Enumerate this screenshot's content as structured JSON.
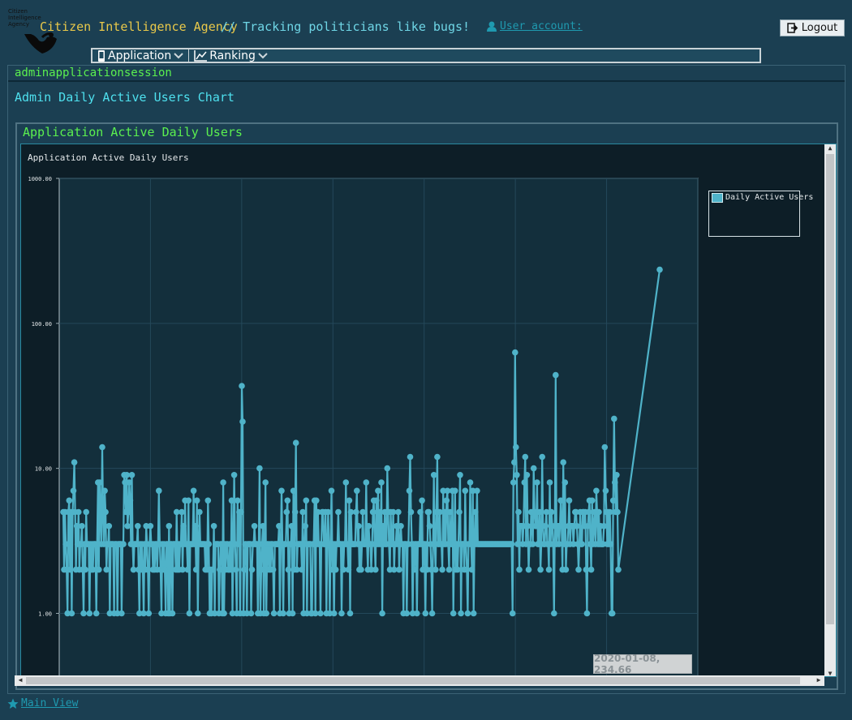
{
  "header": {
    "logo_text": "Citizen Intelligence Agency",
    "title": "Citizen Intelligence Agency",
    "tagline": "// Tracking politicians like bugs!",
    "user_account_label": "User account:",
    "logout_label": "Logout"
  },
  "menu": {
    "items": [
      {
        "label": "Application",
        "icon": "mobile-icon"
      },
      {
        "label": "Ranking",
        "icon": "line-chart-icon"
      }
    ]
  },
  "page": {
    "name": "adminapplicationsession",
    "title": "Admin Daily Active Users Chart",
    "section_title": "Application Active Daily Users",
    "chart_caption": "Application Active Daily Users"
  },
  "tooltip": "2020-01-08, 234.66",
  "footer": {
    "main_view_label": "Main View"
  },
  "colors": {
    "background": "#1b3f52",
    "chart_bg": "#0d1e27",
    "series": "#4fb3c9",
    "title": "#e8c84a",
    "tagline": "#6fd6e6",
    "green_label": "#5bf04f",
    "cyan_label": "#4ee0ee"
  },
  "chart_data": {
    "type": "line",
    "title": "Application Active Daily Users",
    "y_scale": "log",
    "ylim": [
      0.35,
      1000
    ],
    "y_ticks": [
      "1000.00",
      "100.00",
      "10.00",
      "1.00"
    ],
    "y_tick_values": [
      1000,
      100,
      10,
      1
    ],
    "grid": true,
    "legend_position": "right",
    "series": [
      {
        "name": "Daily Active Users",
        "values": [
          5,
          2,
          5,
          3,
          2,
          1,
          5,
          6,
          2,
          5,
          1,
          5,
          7,
          11,
          5,
          2,
          4,
          3,
          5,
          2,
          3,
          3,
          4,
          2,
          1,
          3,
          2,
          5,
          3,
          3,
          3,
          1,
          3,
          2,
          3,
          2,
          3,
          3,
          3,
          1,
          3,
          8,
          2,
          8,
          5,
          3,
          14,
          5,
          3,
          7,
          5,
          2,
          3,
          3,
          4,
          1,
          3,
          3,
          3,
          3,
          1,
          3,
          3,
          3,
          1,
          3,
          3,
          3,
          3,
          1,
          3,
          3,
          9,
          8,
          5,
          9,
          4,
          5,
          8,
          6,
          3,
          9,
          3,
          2,
          3,
          3,
          3,
          3,
          4,
          2,
          1,
          3,
          2,
          3,
          2,
          1,
          3,
          2,
          4,
          3,
          2,
          1,
          3,
          4,
          3,
          3,
          2,
          3,
          2,
          3,
          3,
          2,
          3,
          7,
          3,
          2,
          1,
          3,
          2,
          3,
          2,
          1,
          3,
          3,
          1,
          4,
          1,
          3,
          3,
          1,
          3,
          3,
          3,
          2,
          5,
          2,
          3,
          2,
          3,
          3,
          5,
          2,
          4,
          3,
          6,
          3,
          3,
          2,
          6,
          1,
          3,
          3,
          3,
          3,
          7,
          3,
          4,
          2,
          6,
          1,
          3,
          5,
          3,
          3,
          3,
          3,
          3,
          3,
          2,
          3,
          2,
          6,
          3,
          1,
          2,
          1,
          2,
          2,
          4,
          1,
          3,
          3,
          3,
          3,
          1,
          2,
          3,
          3,
          1,
          8,
          1,
          3,
          2,
          3,
          3,
          2,
          2,
          3,
          2,
          6,
          1,
          3,
          9,
          3,
          2,
          1,
          6,
          3,
          5,
          1,
          5,
          37,
          21,
          1,
          2,
          3,
          3,
          1,
          3,
          3,
          3,
          3,
          1,
          2,
          3,
          3,
          4,
          3,
          3,
          3,
          1,
          3,
          10,
          1,
          2,
          3,
          4,
          1,
          3,
          8,
          1,
          3,
          3,
          2,
          3,
          2,
          3,
          3,
          2,
          1,
          3,
          3,
          3,
          3,
          3,
          4,
          1,
          3,
          7,
          3,
          1,
          3,
          3,
          3,
          5,
          6,
          2,
          1,
          3,
          3,
          4,
          1,
          7,
          2,
          5,
          15,
          2,
          3,
          3,
          3,
          3,
          3,
          2,
          5,
          1,
          3,
          4,
          6,
          1,
          3,
          3,
          3,
          3,
          1,
          1,
          3,
          3,
          6,
          1,
          6,
          3,
          5,
          3,
          3,
          1,
          3,
          5,
          5,
          3,
          3,
          5,
          1,
          3,
          5,
          3,
          1,
          3,
          7,
          2,
          3,
          1,
          3,
          2,
          3,
          3,
          5,
          3,
          3,
          3,
          1,
          3,
          2,
          3,
          3,
          8,
          3,
          3,
          2,
          6,
          1,
          5,
          3,
          3,
          3,
          3,
          3,
          5,
          7,
          3,
          4,
          2,
          3,
          2,
          3,
          5,
          3,
          3,
          3,
          8,
          3,
          2,
          4,
          3,
          3,
          2,
          3,
          5,
          6,
          3,
          2,
          6,
          3,
          7,
          3,
          5,
          3,
          8,
          1,
          4,
          3,
          5,
          3,
          3,
          10,
          5,
          3,
          2,
          5,
          3,
          3,
          5,
          2,
          3,
          3,
          4,
          3,
          5,
          2,
          3,
          4,
          3,
          3,
          1,
          3,
          3,
          3,
          1,
          3,
          3,
          7,
          12,
          5,
          3,
          1,
          3,
          2,
          3,
          3,
          1,
          3,
          3,
          3,
          5,
          3,
          6,
          2,
          3,
          3,
          1,
          3,
          2,
          5,
          5,
          4,
          3,
          2,
          1,
          3,
          9,
          3,
          2,
          5,
          12,
          3,
          3,
          5,
          3,
          3,
          2,
          7,
          3,
          5,
          3,
          6,
          7,
          3,
          2,
          5,
          3,
          3,
          7,
          1,
          3,
          7,
          2,
          3,
          2,
          3,
          5,
          9,
          1,
          3,
          3,
          3,
          2,
          7,
          3,
          2,
          1,
          3,
          3,
          8,
          3,
          2,
          7,
          1,
          3,
          5,
          3,
          7,
          3,
          3,
          3,
          3,
          3,
          3,
          3,
          3,
          3,
          3,
          3,
          3,
          3,
          3,
          3,
          3,
          3,
          3,
          3,
          3,
          3,
          3,
          3,
          3,
          3,
          3,
          3,
          3,
          3,
          3,
          3,
          3,
          3,
          3,
          3,
          3,
          3,
          3,
          3,
          3,
          3,
          1,
          8,
          11,
          63,
          14,
          9,
          3,
          5,
          2,
          4,
          4,
          4,
          3,
          4,
          8,
          12,
          3,
          9,
          4,
          2,
          3,
          3,
          5,
          4,
          3,
          10,
          5,
          4,
          4,
          8,
          3,
          3,
          5,
          2,
          3,
          12,
          4,
          3,
          3,
          4,
          5,
          3,
          3,
          2,
          8,
          3,
          5,
          4,
          3,
          1,
          4,
          44,
          3,
          4,
          4,
          3,
          4,
          6,
          4,
          2,
          11,
          3,
          8,
          2,
          3,
          3,
          4,
          6,
          3,
          4,
          4,
          4,
          3,
          4,
          5,
          5,
          4,
          3,
          2,
          3,
          5,
          3,
          3,
          5,
          5,
          4,
          5,
          2,
          1,
          4,
          5,
          6,
          3,
          2,
          6,
          3,
          4,
          5,
          3,
          7,
          5,
          3,
          5,
          3,
          4,
          3,
          3,
          3,
          4,
          14,
          7,
          5,
          3,
          5,
          3,
          5,
          3,
          1,
          1,
          6,
          22,
          8,
          5,
          9,
          5,
          2,
          234.66
        ]
      }
    ],
    "last_point": {
      "x": "2020-01-08",
      "y": 234.66
    }
  }
}
